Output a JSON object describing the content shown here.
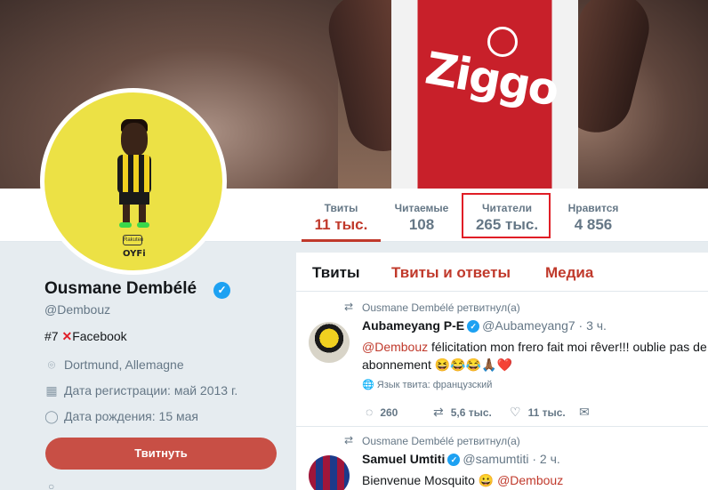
{
  "nav": {
    "tweets_label": "Твиты",
    "tweets_value": "11 тыс.",
    "following_label": "Читаемые",
    "following_value": "108",
    "followers_label": "Читатели",
    "followers_value": "265 тыс.",
    "likes_label": "Нравится",
    "likes_value": "4 856"
  },
  "header": {
    "jersey_text": "Ziggo"
  },
  "avatar": {
    "logo1": "Rakuten",
    "logo2": "OYFi"
  },
  "profile": {
    "name": "Ousmane Dembélé",
    "handle": "@Dembouz",
    "bio_prefix": "#7 ",
    "bio_cross": "✕",
    "bio_suffix": "Facebook",
    "location": "Dortmund, Allemagne",
    "joined": "Дата регистрации: май 2013 г.",
    "birthday": "Дата рождения: 15 мая",
    "tweet_button": "Твитнуть"
  },
  "timeline": {
    "tabs": [
      "Твиты",
      "Твиты и ответы",
      "Медиа"
    ],
    "tweets": [
      {
        "retweet_line": "Ousmane Dembélé ретвитнул(а)",
        "author": "Aubameyang P-E",
        "screen": "@Aubameyang7 · 3 ч.",
        "mention": "@Dembouz",
        "text1": " félicitation mon frero fait moi rêver!!! oublie pas de",
        "text2": "abonnement 😆😂😂🙏🏾❤️",
        "lang": "Язык твита: французский",
        "replies": "260",
        "retweets": "5,6 тыс.",
        "likes": "11 тыс."
      },
      {
        "retweet_line": "Ousmane Dembélé ретвитнул(а)",
        "author": "Samuel Umtiti",
        "screen": "@samumtiti · 2 ч.",
        "text": "Bienvenue Mosquito 😀 ",
        "mention": "@Dembouz"
      }
    ]
  },
  "icons": {
    "retweet": "⇄",
    "reply": "💬",
    "like": "♡",
    "message": "✉",
    "location": "📍",
    "calendar": "📅",
    "balloon": "🎈",
    "globe": "🌐",
    "check": "✓"
  },
  "colors": {
    "accent": "#c0392b",
    "verified": "#1da1f2",
    "highlight": "#e01e26"
  }
}
